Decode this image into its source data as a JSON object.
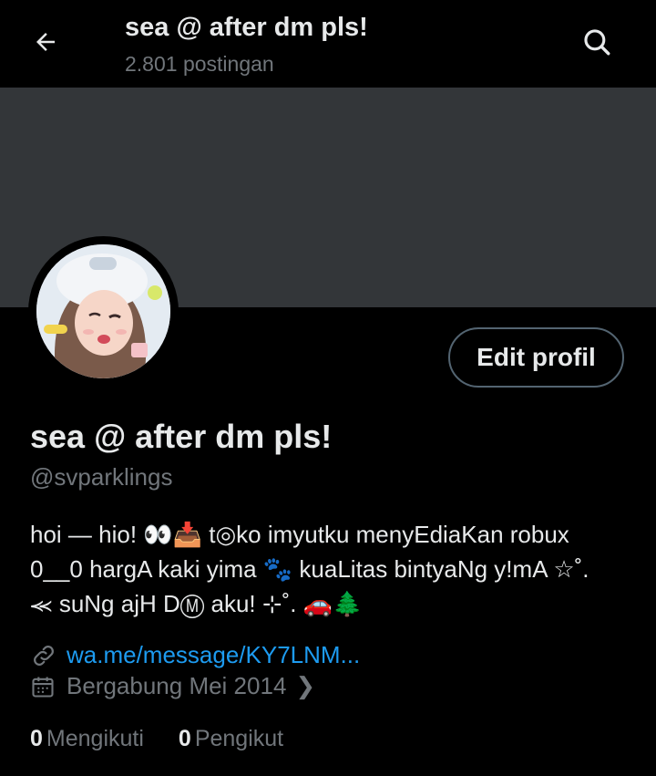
{
  "header": {
    "title": "sea @ after dm pls!",
    "posts_count": "2.801 postingan",
    "back_icon": "arrow-left-icon",
    "search_icon": "search-icon"
  },
  "banner": {
    "color": "#333639"
  },
  "profile": {
    "edit_button": "Edit profil",
    "display_name": "sea @ after dm pls!",
    "handle": "@svparklings",
    "bio_lines": [
      "hoi — hio! 👀📥 t◎ko imyutku menyEdiaKan robux",
      "0__0 hargA kaki yima 🐾 kuaLitas bintyaNg y!mA ☆˚.",
      "⪻ suNg ajH DⓂ aku! ⊹˚. 🚗🌲"
    ],
    "link": "wa.me/message/KY7LNM...",
    "joined": "Bergabung Mei 2014",
    "following_count": "0",
    "following_label": "Mengikuti",
    "followers_count": "0",
    "followers_label": "Pengikut"
  },
  "colors": {
    "background": "#000000",
    "text_primary": "#e7e9ea",
    "text_secondary": "#71767b",
    "link": "#1d9bf0",
    "border": "#536471"
  }
}
